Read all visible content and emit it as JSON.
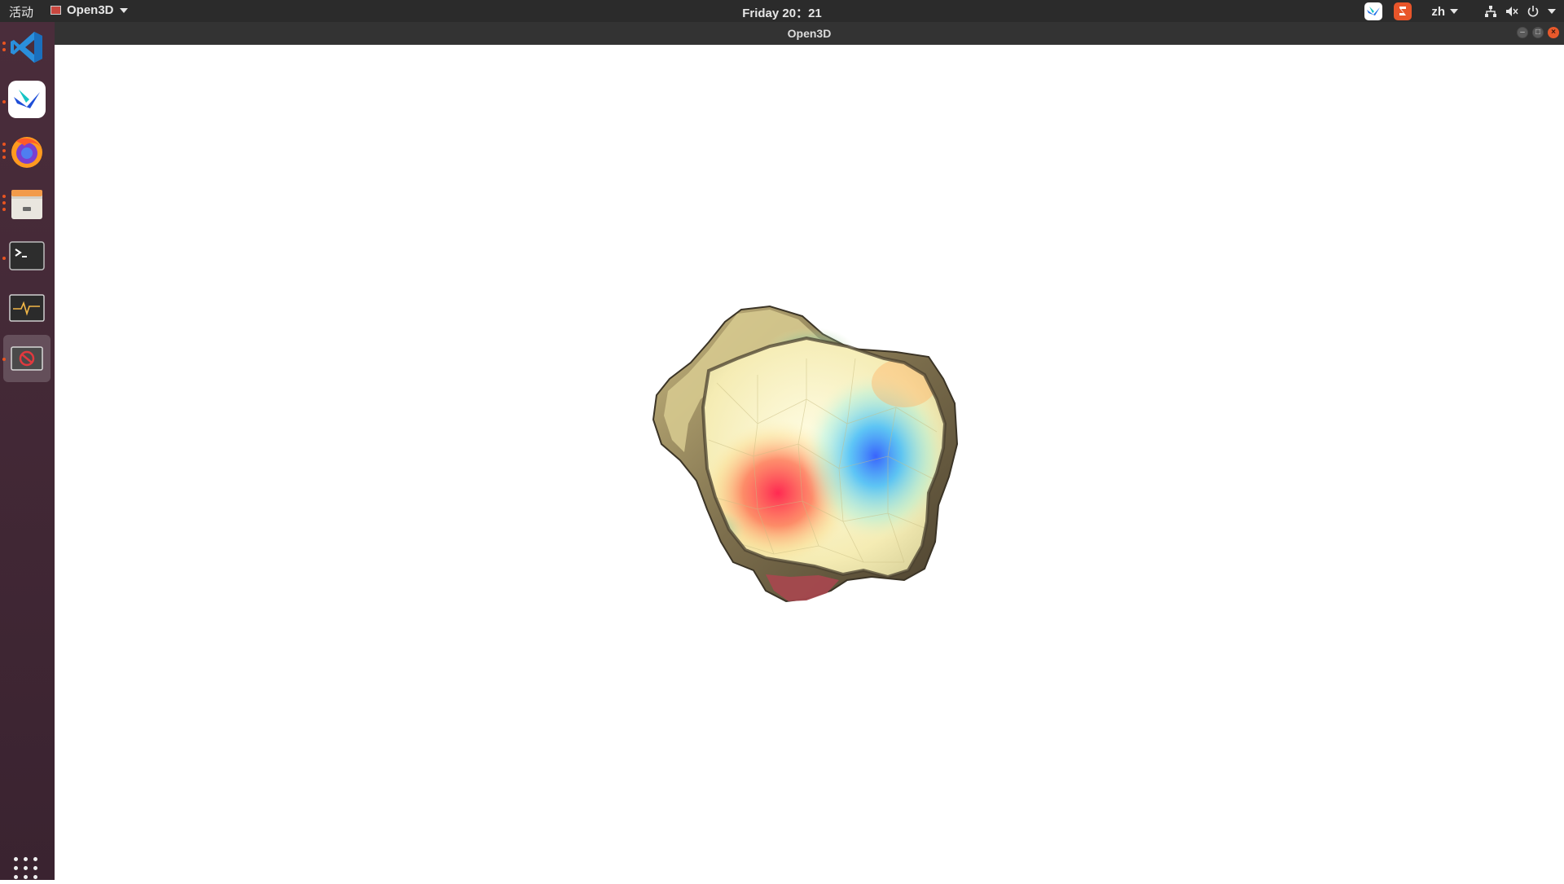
{
  "topbar": {
    "activities": "活动",
    "app_menu_label": "Open3D",
    "clock": "Friday 20：21",
    "language": "zh",
    "tray_icons": [
      "feishu-icon",
      "sogou-icon",
      "network-icon",
      "volume-muted-icon",
      "power-icon"
    ]
  },
  "window": {
    "title": "Open3D"
  },
  "dock": {
    "items": [
      {
        "name": "vscode",
        "running": true
      },
      {
        "name": "feishu",
        "running": true
      },
      {
        "name": "firefox",
        "running": true
      },
      {
        "name": "files",
        "running": true
      },
      {
        "name": "terminal",
        "running": true
      },
      {
        "name": "system-monitor",
        "running": false
      },
      {
        "name": "open3d",
        "running": true,
        "active": true
      }
    ]
  },
  "colors": {
    "topbar_bg": "#2b2b2b",
    "dock_bg": "#4a2d3b",
    "accent_orange": "#e95420",
    "viewport_bg": "#ffffff"
  }
}
